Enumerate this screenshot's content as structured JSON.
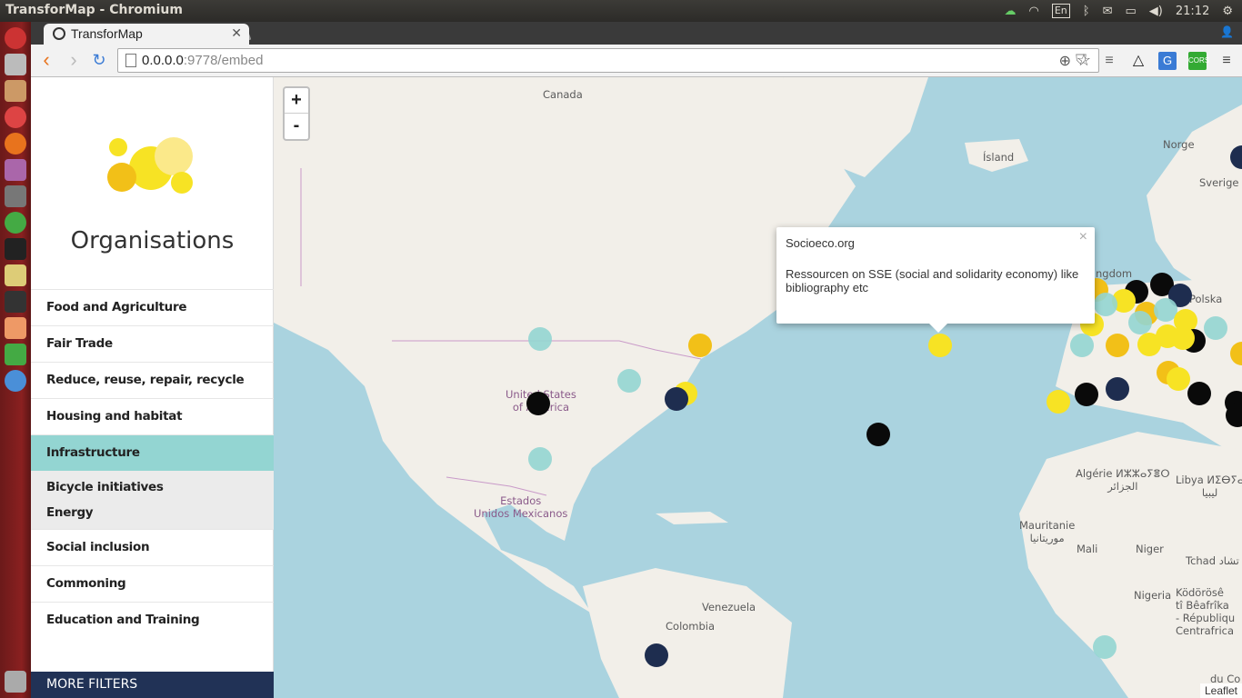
{
  "os": {
    "window_title": "TransforMap - Chromium",
    "clock": "21:12",
    "keyboard_layout": "En"
  },
  "browser": {
    "tab_title": "TransforMap",
    "url_host": "0.0.0.0",
    "url_rest": ":9778/embed"
  },
  "sidebar": {
    "title": "Organisations",
    "categories": [
      {
        "label": "Food and Agriculture"
      },
      {
        "label": "Fair Trade"
      },
      {
        "label": "Reduce, reuse, repair, recycle"
      },
      {
        "label": "Housing and habitat"
      },
      {
        "label": "Infrastructure"
      },
      {
        "label": "Social inclusion"
      },
      {
        "label": "Commoning"
      },
      {
        "label": "Education and Training"
      }
    ],
    "subcategories": [
      {
        "label": "Bicycle initiatives"
      },
      {
        "label": "Energy"
      }
    ],
    "more_filters": "MORE FILTERS"
  },
  "map": {
    "zoom_in": "+",
    "zoom_out": "-",
    "attribution": "Leaflet",
    "labels": {
      "canada": "Canada",
      "island": "Ísland",
      "norge": "Norge",
      "sverige": "Sverige",
      "kingdom": "ngdom",
      "polska": "Polska",
      "usa": "United States\nof America",
      "mexico": "Estados\nUnidos Mexicanos",
      "algerie": "Algérie ⵍⵣⵣⴰⵢⴻⵔ\nالجزائر",
      "libya": "Libya ⵍⵉⴱⵢⴰ\nليبيا",
      "mauritanie": "Mauritanie\nموريتانيا",
      "mali": "Mali",
      "niger": "Niger",
      "tchad": "Tchad تشاد",
      "nigeria": "Nigeria",
      "venezuela": "Venezuela",
      "colombia": "Colombia",
      "kodorose": "Ködörösê\ntî Bêafrîka\n- Républiqu\nCentrafrica",
      "dc": "du Co"
    },
    "popup": {
      "title": "Socioeco.org",
      "description": "Ressourcen on SSE (social and solidarity economy) like bibliography etc",
      "close": "×"
    },
    "marker_colors": {
      "yellow": "#f7e324",
      "gold": "#f2c018",
      "teal": "#93d5d2",
      "navy": "#1e2d4f",
      "black": "#0a0a0a"
    }
  }
}
